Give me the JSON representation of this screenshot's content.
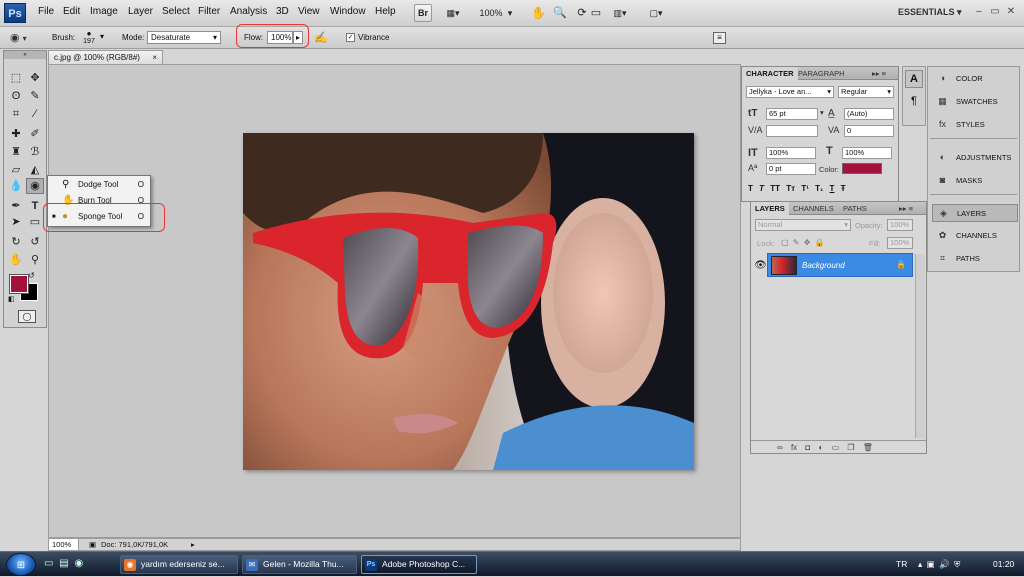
{
  "app": {
    "logo_text": "Ps",
    "workspace": "ESSENTIALS",
    "essentials_arrow": "▾"
  },
  "menu": [
    "File",
    "Edit",
    "Image",
    "Layer",
    "Select",
    "Filter",
    "Analysis",
    "3D",
    "View",
    "Window",
    "Help"
  ],
  "menubar_right": {
    "bridge_label": "Br",
    "zoom": "100%",
    "zoom_arrow": "▾",
    "minimize": "–",
    "restore": "▭",
    "close": "✕"
  },
  "options": {
    "brush_label": "Brush:",
    "brush_size": "197",
    "mode_label": "Mode:",
    "mode_value": "Desaturate",
    "flow_label": "Flow:",
    "flow_value": "100%",
    "vibrance_label": "Vibrance",
    "vibrance_checked": true,
    "check_mark": "✓"
  },
  "document": {
    "tab_title": "c.jpg @ 100% (RGB/8#)",
    "tab_close": "×",
    "zoom": "100%",
    "doc_info": "Doc: 791,0K/791,0K"
  },
  "flyout": {
    "items": [
      {
        "label": "Dodge Tool",
        "shortcut": "O",
        "active": false
      },
      {
        "label": "Burn Tool",
        "shortcut": "O",
        "active": false
      },
      {
        "label": "Sponge Tool",
        "shortcut": "O",
        "active": true
      }
    ],
    "active_marker": "■"
  },
  "character_panel": {
    "tabs": [
      "CHARACTER",
      "PARAGRAPH"
    ],
    "menu_glyph": "▸▸ ≡",
    "font_family": "Jellyka - Love an...",
    "font_style": "Regular",
    "font_size": "65 pt",
    "leading": "(Auto)",
    "kerning": "",
    "tracking": "0",
    "vertical_scale": "100%",
    "horizontal_scale": "100%",
    "baseline_shift": "0 pt",
    "color_label": "Color:",
    "color_swatch": "#a3123a",
    "style_buttons": [
      "T",
      "T",
      "TT",
      "Tт",
      "T¹",
      "T₁",
      "T",
      "Ŧ"
    ]
  },
  "layers_panel": {
    "tabs": [
      "LAYERS",
      "CHANNELS",
      "PATHS"
    ],
    "menu_glyph": "▸▸ ≡",
    "blend_mode": "Normal",
    "opacity_label": "Opacity:",
    "opacity_value": "100%",
    "lock_label": "Lock:",
    "fill_label": "Fill:",
    "fill_value": "100%",
    "layers": [
      {
        "name": "Background",
        "visible": true,
        "locked": true
      }
    ],
    "footer_icons": [
      "∞",
      "fx",
      "◘",
      "◐",
      "▭",
      "❐",
      "🗑"
    ]
  },
  "dock": {
    "items": [
      {
        "label": "COLOR",
        "icon": "color-icon",
        "glyph": "◑",
        "active": false
      },
      {
        "label": "SWATCHES",
        "icon": "swatches-icon",
        "glyph": "▦",
        "active": false
      },
      {
        "label": "STYLES",
        "icon": "styles-icon",
        "glyph": "fx",
        "active": false
      },
      {
        "label": "ADJUSTMENTS",
        "icon": "adjustments-icon",
        "glyph": "◐",
        "active": false
      },
      {
        "label": "MASKS",
        "icon": "masks-icon",
        "glyph": "◙",
        "active": false
      },
      {
        "label": "LAYERS",
        "icon": "layers-icon",
        "glyph": "◈",
        "active": true
      },
      {
        "label": "CHANNELS",
        "icon": "channels-icon",
        "glyph": "✿",
        "active": false
      },
      {
        "label": "PATHS",
        "icon": "paths-icon",
        "glyph": "⌗",
        "active": false
      }
    ],
    "narrow_icons": [
      "A",
      "¶"
    ]
  },
  "colors": {
    "foreground": "#a3123a",
    "background": "#000000",
    "accent": "#3b8be4",
    "highlight": "#e33333"
  },
  "taskbar": {
    "tasks": [
      {
        "label": "yardım ederseniz se...",
        "icon": "firefox-icon",
        "glyph": "◉",
        "active": false
      },
      {
        "label": "Gelen - Mozilla Thu...",
        "icon": "thunderbird-icon",
        "glyph": "✉",
        "active": false
      },
      {
        "label": "Adobe Photoshop C...",
        "icon": "photoshop-icon",
        "glyph": "Ps",
        "active": true
      }
    ],
    "language": "TR",
    "clock": "01:20"
  }
}
